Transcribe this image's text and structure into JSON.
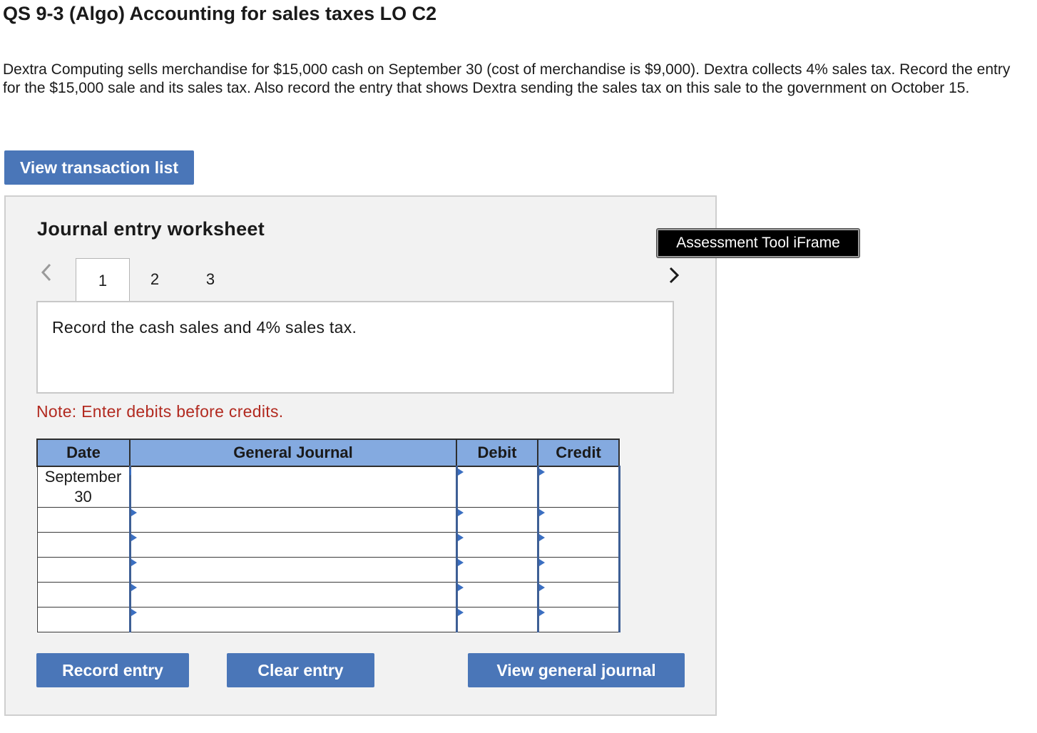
{
  "question": {
    "title": "QS 9-3 (Algo) Accounting for sales taxes LO C2",
    "text": "Dextra Computing sells merchandise for $15,000 cash on September 30 (cost of merchandise is $9,000). Dextra collects 4% sales tax. Record the entry for the $15,000 sale and its sales tax. Also record the entry that shows Dextra sending the sales tax on this sale to the government on October 15."
  },
  "buttons": {
    "view_transaction_list": "View transaction list",
    "record_entry": "Record entry",
    "clear_entry": "Clear entry",
    "view_general_journal": "View general journal"
  },
  "worksheet": {
    "title": "Journal entry worksheet",
    "iframe_label": "Assessment Tool iFrame",
    "tabs": [
      "1",
      "2",
      "3"
    ],
    "active_tab": "1",
    "instruction": "Record the cash sales and 4% sales tax.",
    "note": "Note: Enter debits before credits."
  },
  "journal": {
    "headers": {
      "date": "Date",
      "general_journal": "General Journal",
      "debit": "Debit",
      "credit": "Credit"
    },
    "rows": [
      {
        "date_line1": "September",
        "date_line2": "30",
        "account": "",
        "debit": "",
        "credit": ""
      },
      {
        "date_line1": "",
        "date_line2": "",
        "account": "",
        "debit": "",
        "credit": ""
      },
      {
        "date_line1": "",
        "date_line2": "",
        "account": "",
        "debit": "",
        "credit": ""
      },
      {
        "date_line1": "",
        "date_line2": "",
        "account": "",
        "debit": "",
        "credit": ""
      },
      {
        "date_line1": "",
        "date_line2": "",
        "account": "",
        "debit": "",
        "credit": ""
      },
      {
        "date_line1": "",
        "date_line2": "",
        "account": "",
        "debit": "",
        "credit": ""
      }
    ]
  },
  "icons": {
    "prev": "chevron-left-icon",
    "next": "chevron-right-icon",
    "cell_marker": "triangle-right-icon"
  },
  "colors": {
    "button_blue": "#4a76b8",
    "header_blue": "#84aae0",
    "note_red": "#b22a20",
    "panel_bg": "#f2f2f2"
  }
}
